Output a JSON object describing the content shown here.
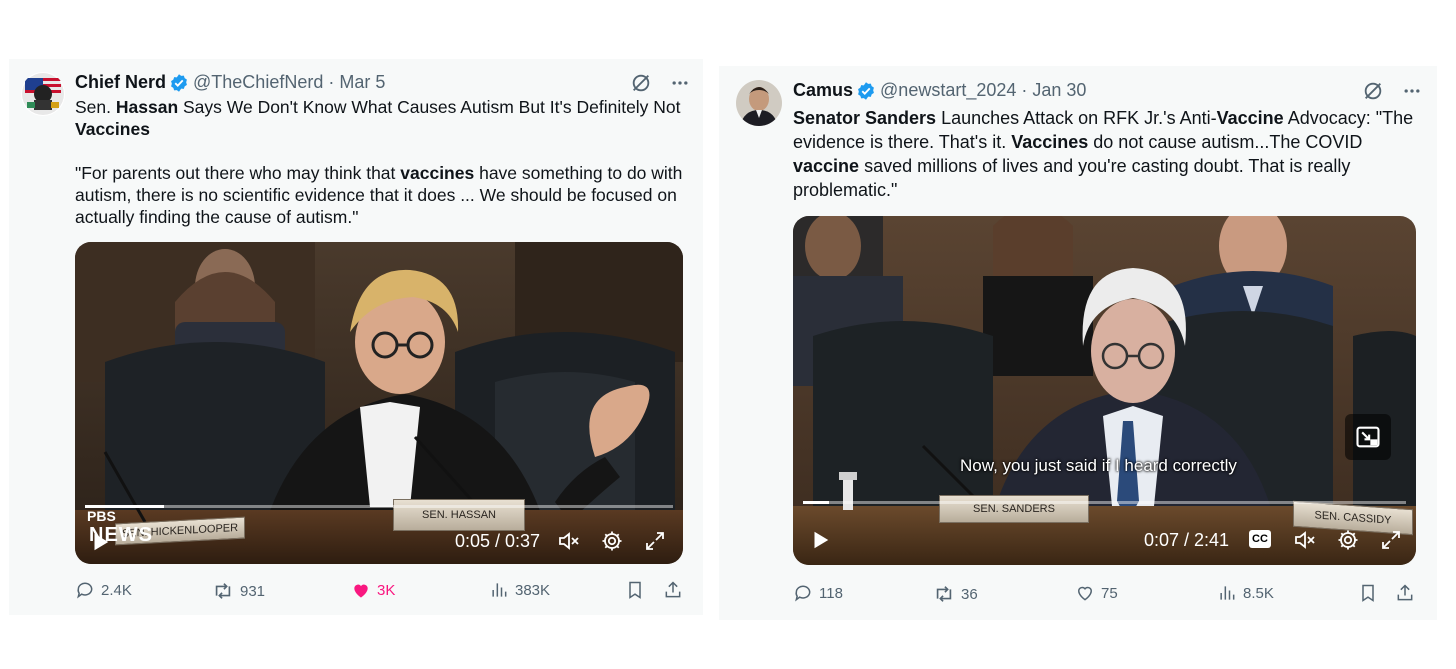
{
  "tweets": [
    {
      "author": {
        "name": "Chief Nerd",
        "handle": "@TheChiefNerd",
        "date": "· Mar 5"
      },
      "title_parts": [
        "Sen. ",
        "Hassan",
        " Says We Don't Know What Causes Autism But It's Definitely Not ",
        "Vaccines"
      ],
      "quote_parts": [
        "\"For parents out there who may think that ",
        "vaccines",
        " have something to do with autism, there is no scientific evidence that it does ... We should be focused on actually finding the cause of autism.\""
      ],
      "video": {
        "time": "0:05 / 0:37",
        "progress": 0.135,
        "nameplate_main": "SEN. HASSAN",
        "nameplate_left": "SEN. HICKENLOOPER",
        "logo_top": "PBS",
        "logo_bottom": "NEWS"
      },
      "stats": {
        "replies": "2.4K",
        "reposts": "931",
        "likes": "3K",
        "views": "383K",
        "liked": true
      }
    },
    {
      "author": {
        "name": "Camus",
        "handle": "@newstart_2024",
        "date": "· Jan 30"
      },
      "text_parts": [
        "Senator Sanders",
        " Launches Attack on RFK Jr.'s Anti-",
        "Vaccine",
        " Advocacy: \"The evidence is there. That's it. ",
        "Vaccines",
        " do not cause autism...The COVID ",
        "vaccine",
        " saved millions of lives and you're casting doubt. That is really problematic.\""
      ],
      "video": {
        "time": "0:07 / 2:41",
        "progress": 0.043,
        "caption": "Now, you just said if I heard correctly",
        "nameplate_main": "SEN. SANDERS",
        "nameplate_right": "SEN. CASSIDY",
        "cc_label": "CC"
      },
      "stats": {
        "replies": "118",
        "reposts": "36",
        "likes": "75",
        "views": "8.5K",
        "liked": false
      }
    }
  ],
  "colors": {
    "like_active": "#f91880",
    "verified": "#1d9bf0",
    "muted": "#536471"
  }
}
